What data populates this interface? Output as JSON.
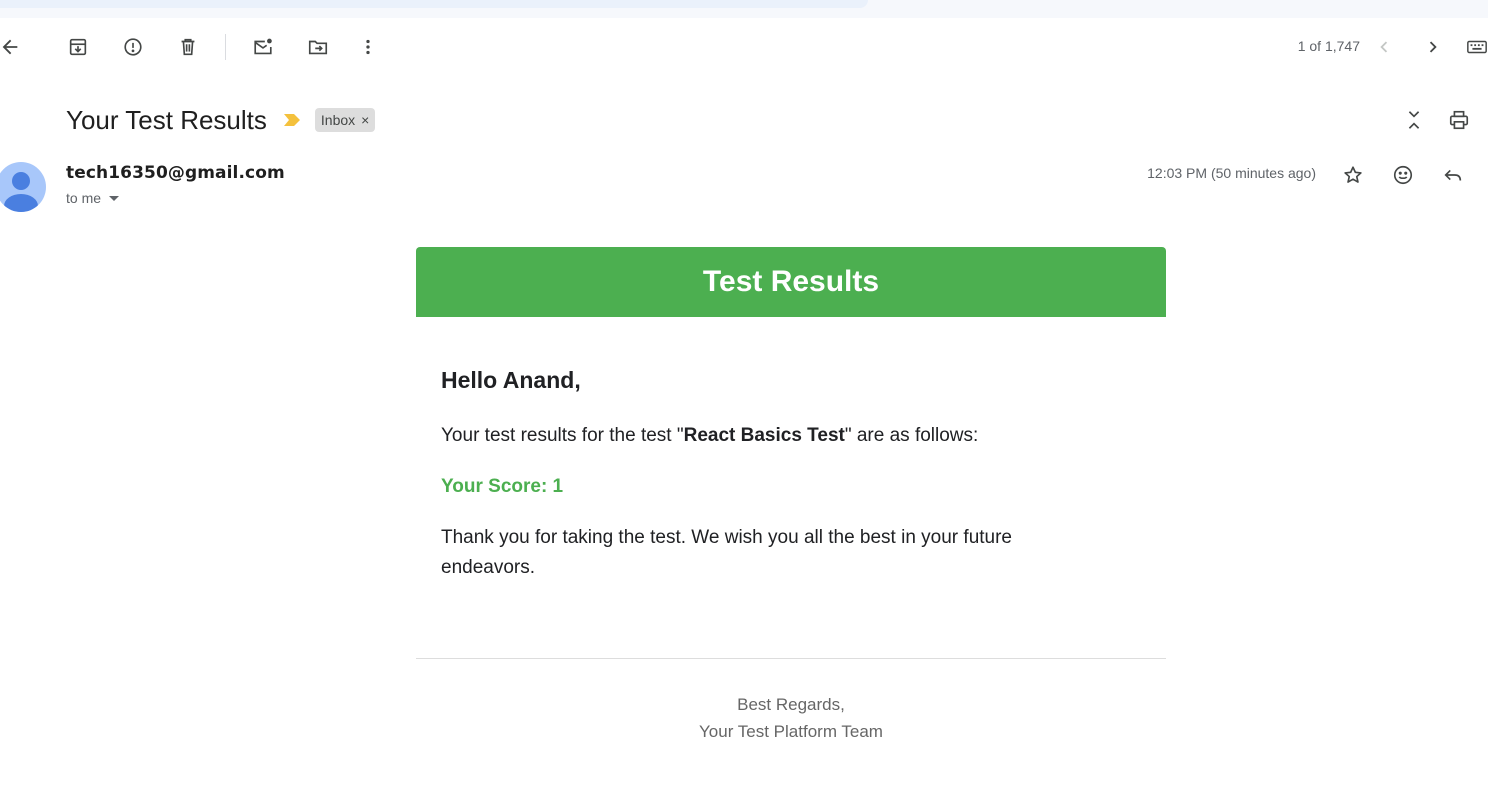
{
  "toolbar": {
    "pager_text": "1 of 1,747"
  },
  "email": {
    "subject": "Your Test Results",
    "label_chip": "Inbox",
    "label_chip_close": "×",
    "sender": "tech16350@gmail.com",
    "recipient_text": "to me",
    "timestamp": "12:03 PM (50 minutes ago)"
  },
  "body": {
    "banner_title": "Test Results",
    "greeting": "Hello Anand,",
    "intro_prefix": "Your test results for the test \"",
    "test_name": "React Basics Test",
    "intro_suffix": "\" are as follows:",
    "score": "Your Score: 1",
    "thanks": "Thank you for taking the test. We wish you all the best in your future endeavors.",
    "signoff_line1": "Best Regards,",
    "signoff_line2": "Your Test Platform Team"
  },
  "colors": {
    "banner": "#4caf50",
    "score": "#4caf50",
    "label_arrow": "#f4c13d",
    "chip_bg": "#dddddd",
    "avatar_bg": "#a8c7fa",
    "avatar_fg": "#4a7fe0"
  },
  "icons": {
    "back": "arrow-left-icon",
    "archive": "archive-icon",
    "spam": "report-spam-icon",
    "delete": "trash-icon",
    "unread": "mark-unread-icon",
    "move": "move-to-icon",
    "more": "more-vert-icon",
    "prev": "chevron-left-icon",
    "next": "chevron-right-icon",
    "keyboard": "keyboard-icon",
    "collapse": "collapse-all-icon",
    "print": "print-icon",
    "star": "star-icon",
    "emoji": "emoji-icon",
    "reply": "reply-icon"
  }
}
